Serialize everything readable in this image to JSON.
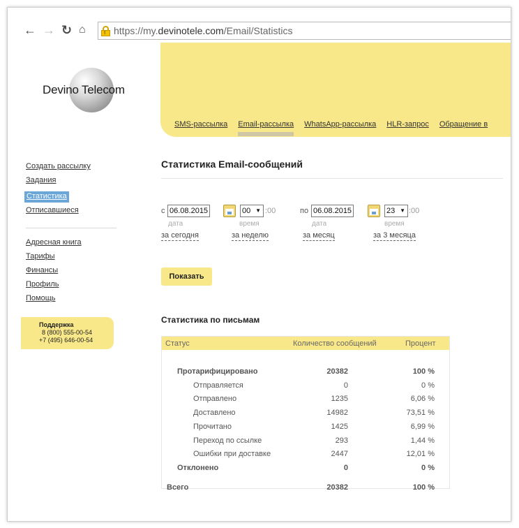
{
  "browser": {
    "url_prefix": "https://my.",
    "url_domain": "devinotele.com",
    "url_path": "/Email/Statistics"
  },
  "logo": {
    "text": "Devino Telecom"
  },
  "menu": [
    "SMS-рассылка",
    "Email-рассылка",
    "WhatsApp-рассылка",
    "HLR-запрос",
    "Обращение в"
  ],
  "sidebar": {
    "group1": [
      "Создать рассылку",
      "Задания",
      "Статистика",
      "Отписавшиеся"
    ],
    "group2": [
      "Адресная книга",
      "Тарифы",
      "Финансы",
      "Профиль",
      "Помощь"
    ]
  },
  "support": {
    "title": "Поддержка",
    "phone1": "8 (800) 555-00-54",
    "phone2": "+7 (495) 646-00-54"
  },
  "page": {
    "title": "Статистика Email-сообщений"
  },
  "filter": {
    "from_label": "с",
    "from_date": "06.08.2015",
    "from_hour": "00",
    "to_label": "по",
    "to_date": "06.08.2015",
    "to_hour": "23",
    "minutes": ":00",
    "hint_date": "дата",
    "hint_time": "время",
    "quick": [
      "за сегодня",
      "за неделю",
      "за месяц",
      "за 3 месяца"
    ],
    "show_button": "Показать"
  },
  "stats": {
    "title": "Статистика по письмам",
    "headers": {
      "status": "Статус",
      "count": "Количество сообщений",
      "percent": "Процент"
    },
    "rows": [
      {
        "status": "Протарифицировано",
        "count": "20382",
        "percent": "100 %",
        "bold": true,
        "indent": 1
      },
      {
        "status": "Отправляется",
        "count": "0",
        "percent": "0 %",
        "bold": false,
        "indent": 2
      },
      {
        "status": "Отправлено",
        "count": "1235",
        "percent": "6,06 %",
        "bold": false,
        "indent": 2
      },
      {
        "status": "Доставлено",
        "count": "14982",
        "percent": "73,51 %",
        "bold": false,
        "indent": 2
      },
      {
        "status": "Прочитано",
        "count": "1425",
        "percent": "6,99 %",
        "bold": false,
        "indent": 2
      },
      {
        "status": "Переход по ссылке",
        "count": "293",
        "percent": "1,44 %",
        "bold": false,
        "indent": 2
      },
      {
        "status": "Ошибки при доставке",
        "count": "2447",
        "percent": "12,01 %",
        "bold": false,
        "indent": 2
      },
      {
        "status": "Отклонено",
        "count": "0",
        "percent": "0 %",
        "bold": true,
        "indent": 1
      }
    ],
    "total": {
      "status": "Всего",
      "count": "20382",
      "percent": "100 %"
    }
  }
}
